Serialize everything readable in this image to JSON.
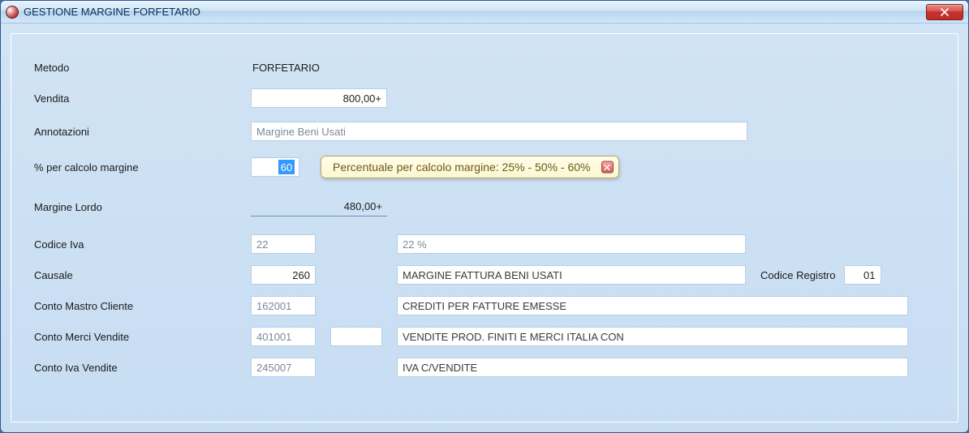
{
  "window": {
    "title": "GESTIONE MARGINE FORFETARIO"
  },
  "labels": {
    "metodo": "Metodo",
    "vendita": "Vendita",
    "annotazioni": "Annotazioni",
    "percent_margine": "% per calcolo margine",
    "margine_lordo": "Margine Lordo",
    "codice_iva": "Codice Iva",
    "causale": "Causale",
    "conto_mastro_cliente": "Conto Mastro Cliente",
    "conto_merci_vendite": "Conto Merci Vendite",
    "conto_iva_vendite": "Conto Iva Vendite",
    "codice_registro": "Codice Registro"
  },
  "values": {
    "metodo": "FORFETARIO",
    "vendita": "800,00+",
    "annotazioni": "Margine Beni Usati",
    "percent_margine": "60",
    "margine_lordo": "480,00+",
    "codice_iva": "22",
    "codice_iva_desc": "22 %",
    "causale": "260",
    "causale_desc": "MARGINE FATTURA BENI USATI",
    "codice_registro": "01",
    "conto_mastro_cliente": "162001",
    "conto_mastro_cliente_desc": "CREDITI PER FATTURE EMESSE",
    "conto_merci_vendite": "401001",
    "conto_merci_vendite_sub": "",
    "conto_merci_vendite_desc": "VENDITE PROD. FINITI E MERCI ITALIA CON",
    "conto_iva_vendite": "245007",
    "conto_iva_vendite_desc": "IVA C/VENDITE"
  },
  "tooltip": {
    "text": "Percentuale per calcolo margine: 25% - 50% - 60%"
  }
}
